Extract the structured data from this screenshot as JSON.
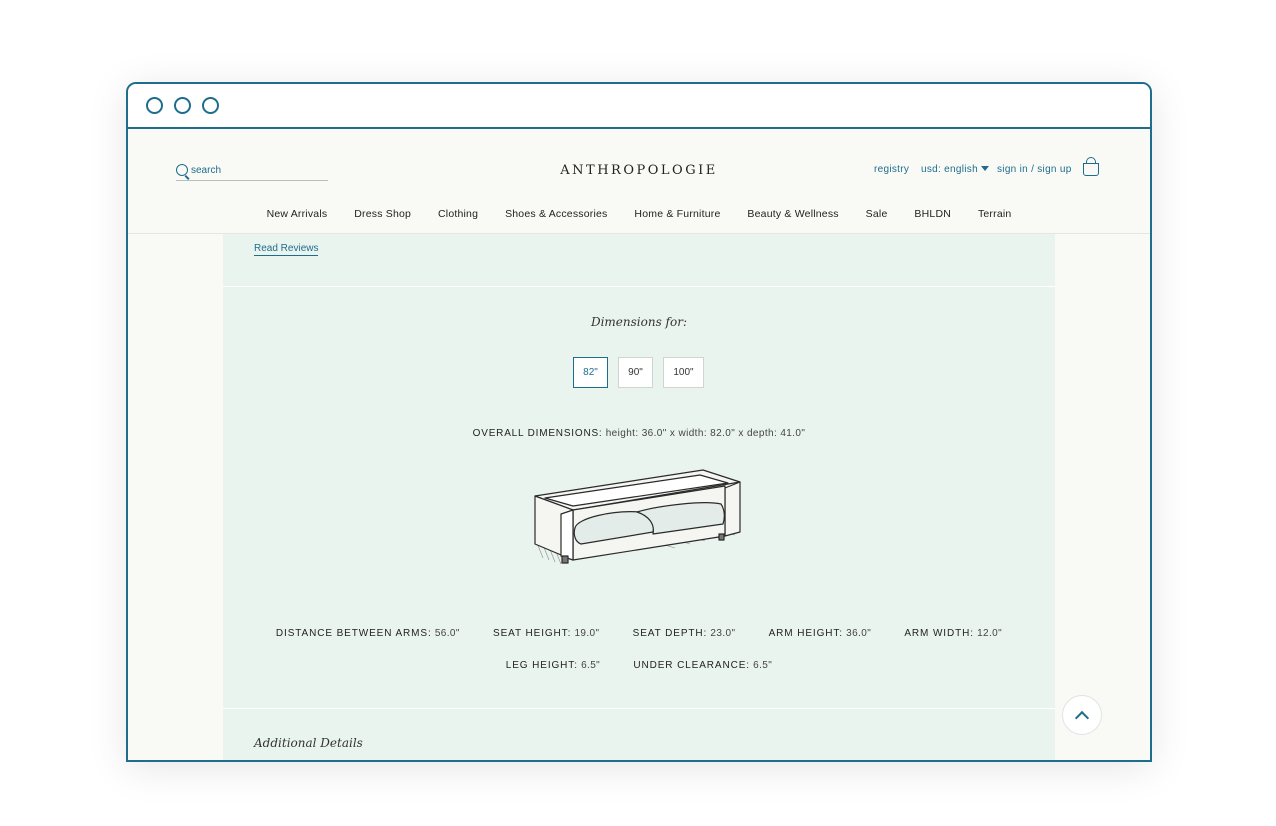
{
  "header": {
    "search_placeholder": "search",
    "logo": "ANTHROPOLOGIE",
    "registry": "registry",
    "locale": "usd: english",
    "signin": "sign in / sign up"
  },
  "nav": [
    "New Arrivals",
    "Dress Shop",
    "Clothing",
    "Shoes & Accessories",
    "Home & Furniture",
    "Beauty & Wellness",
    "Sale",
    "BHLDN",
    "Terrain"
  ],
  "reviews_link": "Read Reviews",
  "dimensions": {
    "heading": "Dimensions for:",
    "sizes": [
      "82\"",
      "90\"",
      "100\""
    ],
    "selected_size": "82\"",
    "overall_label": "OVERALL DIMENSIONS:",
    "overall_value": "height: 36.0\" x width: 82.0\" x depth: 41.0\"",
    "specs_row1": [
      {
        "label": "DISTANCE BETWEEN ARMS:",
        "value": "56.0\""
      },
      {
        "label": "SEAT HEIGHT:",
        "value": "19.0\""
      },
      {
        "label": "SEAT DEPTH:",
        "value": "23.0\""
      },
      {
        "label": "ARM HEIGHT:",
        "value": "36.0\""
      },
      {
        "label": "ARM WIDTH:",
        "value": "12.0\""
      }
    ],
    "specs_row2": [
      {
        "label": "LEG HEIGHT:",
        "value": "6.5\""
      },
      {
        "label": "UNDER CLEARANCE:",
        "value": "6.5\""
      }
    ]
  },
  "additional_details": "Additional Details",
  "colors": {
    "accent": "#1e6d8c",
    "panel": "#eaf4ef",
    "page": "#f9faf6"
  },
  "icons": {
    "search": "search-icon",
    "bag": "shopping-bag-icon",
    "top": "chevron-up-icon"
  }
}
